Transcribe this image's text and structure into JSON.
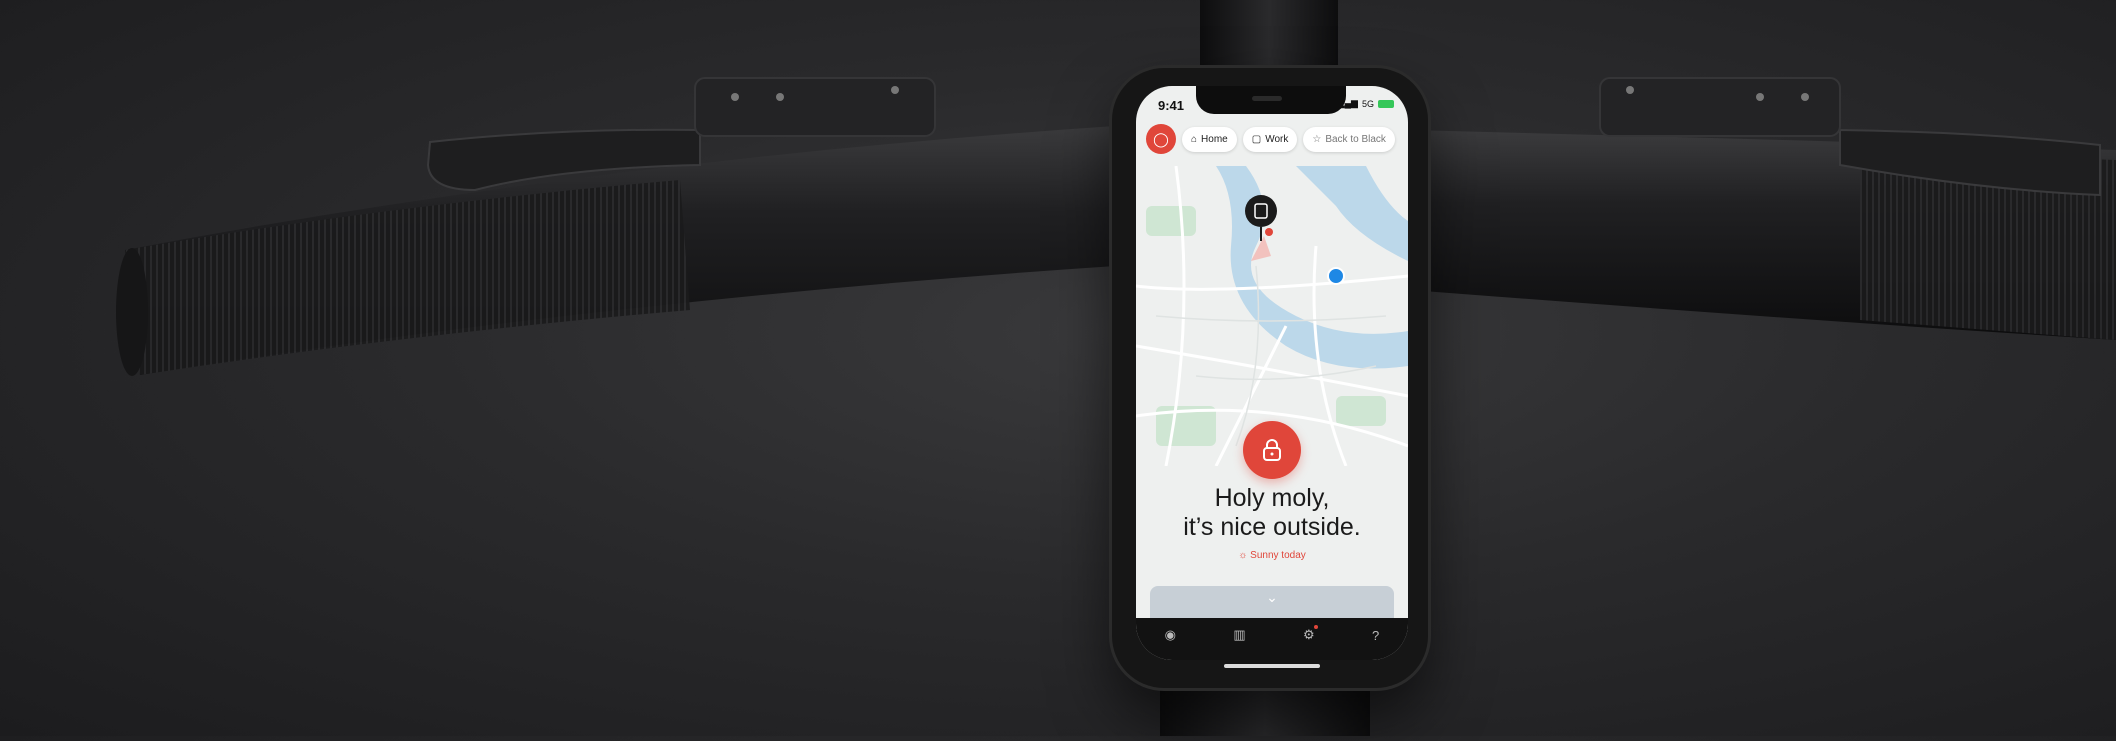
{
  "status_bar": {
    "time": "9:41",
    "network": "5G"
  },
  "chips": [
    {
      "icon": "home-icon",
      "label": "Home"
    },
    {
      "icon": "briefcase-icon",
      "label": "Work"
    },
    {
      "icon": "star-icon",
      "label": "Back to Black"
    }
  ],
  "headline": {
    "line1": "Holy moly,",
    "line2": "it’s nice outside."
  },
  "weather": {
    "icon": "sun-icon",
    "label": "Sunny today"
  },
  "tabs": [
    "speedometer-icon",
    "stats-icon",
    "settings-icon",
    "help-icon"
  ],
  "colors": {
    "accent": "#e0463a",
    "water": "#bcd8ea",
    "park": "#cfe6d3",
    "location": "#1e88e5"
  }
}
